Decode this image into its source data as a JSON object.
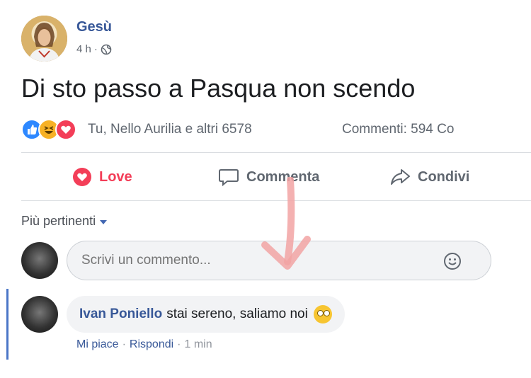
{
  "post": {
    "author": "Gesù",
    "time": "4 h",
    "meta_separator": "·",
    "text": "Di sto passo a Pasqua non scendo"
  },
  "reactions": {
    "icons": [
      "like-reaction-icon",
      "haha-reaction-icon",
      "love-reaction-icon"
    ],
    "names_text": "Tu, Nello Aurilia e altri 6578",
    "comments_text": "Commenti: 594  Co"
  },
  "actions": {
    "love_label": "Love",
    "comment_label": "Commenta",
    "share_label": "Condivi"
  },
  "comments": {
    "sort_label": "Più pertinenti",
    "input_placeholder": "Scrivi un commento...",
    "items": [
      {
        "author": "Ivan Poniello",
        "text": "stai sereno, saliamo noi",
        "like_label": "Mi piace",
        "reply_label": "Rispondi",
        "time": "1 min"
      }
    ]
  },
  "colors": {
    "link_blue": "#385898",
    "love_red": "#f33e58",
    "overlay_arrow": "#f2a3a3"
  }
}
